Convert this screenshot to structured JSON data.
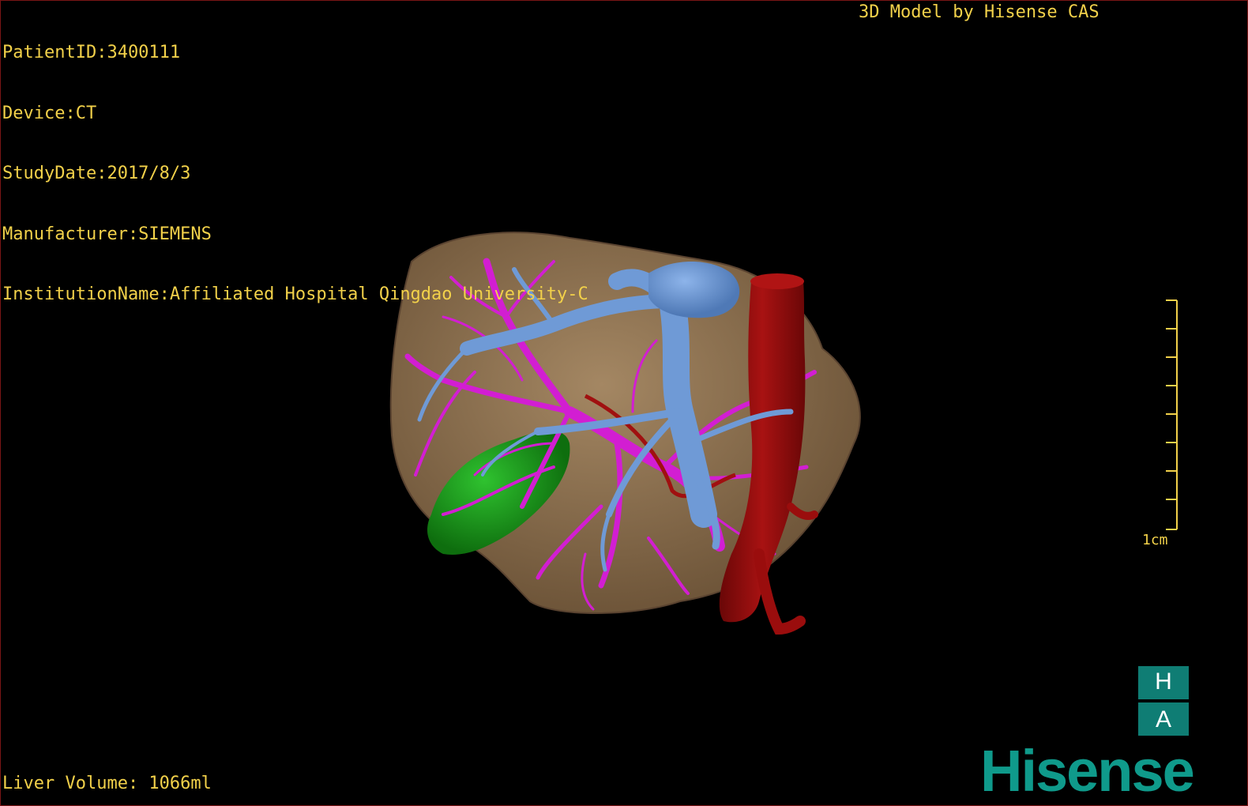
{
  "overlay": {
    "patient_id": "PatientID:3400111",
    "device": "Device:CT",
    "study_date": "StudyDate:2017/8/3",
    "manufacturer": "Manufacturer:SIEMENS",
    "institution": "InstitutionName:Affiliated Hospital Qingdao University-C",
    "model_credit": "3D Model by Hisense CAS",
    "liver_volume": "Liver Volume: 1066ml"
  },
  "scale_bar": {
    "label": "1cm"
  },
  "orientation": {
    "top": "H",
    "bottom": "A"
  },
  "logo": {
    "text": "Hisense"
  },
  "colors": {
    "overlay_text": "#f2d14a",
    "liver": "#8b6f4e",
    "portal_vein": "#6f9ad6",
    "hepatic_vessels": "#d21ed2",
    "artery": "#8e0b0b",
    "gallbladder": "#1d9a1d",
    "brand": "#0f9a8b"
  }
}
